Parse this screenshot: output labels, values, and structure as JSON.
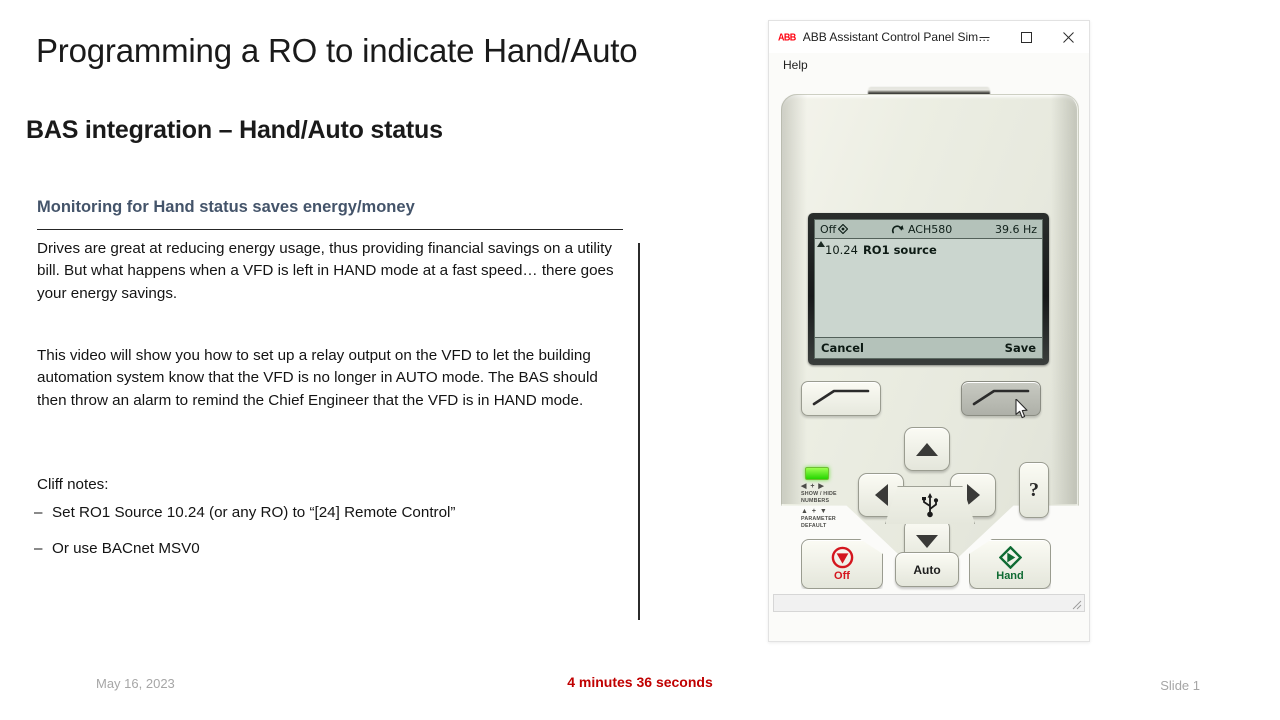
{
  "slide": {
    "title": "Programming a RO to indicate Hand/Auto",
    "subtitle": "BAS integration – Hand/Auto status",
    "section_heading": "Monitoring for Hand status saves energy/money",
    "section_heading_color": "#44546a",
    "paragraph_1": "Drives are great at reducing energy usage, thus providing financial savings on a utility bill.  But what happens when a VFD is left in HAND mode at a fast speed… there goes your energy savings.",
    "paragraph_2": "This video will show you how to set up a relay output on the VFD to let the building automation system know that the VFD is no longer in AUTO mode. The BAS should then throw an alarm to remind the Chief Engineer that the VFD is in HAND mode.",
    "cliff_label": "Cliff notes:",
    "bullets": [
      {
        "dash": "–",
        "text": "Set RO1 Source 10.24 (or any RO) to “[24] Remote Control”"
      },
      {
        "dash": "–",
        "text": "Or use BACnet MSV0"
      }
    ]
  },
  "footer": {
    "date": "May 16, 2023",
    "duration": "4 minutes 36 seconds",
    "duration_color": "#c00000",
    "slide_number": "Slide 1"
  },
  "app_window": {
    "logo_text": "ABB",
    "logo_color": "#ff000f",
    "title": "ABB Assistant Control Panel Sim…",
    "window_buttons": [
      {
        "name": "minimize",
        "label": "–"
      },
      {
        "name": "maximize",
        "label": "□"
      },
      {
        "name": "close",
        "label": "✕"
      }
    ],
    "menu": [
      {
        "label": "Help"
      }
    ]
  },
  "control_panel": {
    "lcd": {
      "status_left": "Off",
      "status_left_icon": "local-control-diamond-icon",
      "status_rotate_icon": "rotation-direction-icon",
      "drive_name": "ACH580",
      "frequency": "39.6 Hz",
      "parameter_number": "10.24",
      "parameter_name": "RO1 source",
      "softkey_left_label": "Cancel",
      "softkey_right_label": "Save",
      "background_color": "#c3cfc8"
    },
    "soft_keys": [
      {
        "name": "soft-key-left",
        "state": "normal"
      },
      {
        "name": "soft-key-right",
        "state": "pressed"
      }
    ],
    "nav_keys": [
      {
        "name": "nav-up-button",
        "icon": "triangle-up-icon"
      },
      {
        "name": "nav-left-button",
        "icon": "triangle-left-icon"
      },
      {
        "name": "nav-right-button",
        "icon": "triangle-right-icon"
      },
      {
        "name": "nav-down-button",
        "icon": "triangle-down-icon"
      }
    ],
    "help_key_label": "?",
    "legend": {
      "led_color": "#25d600",
      "combo_1": "◀ + ▶",
      "line_1a": "SHOW / HIDE",
      "line_1b": "NUMBERS",
      "combo_2": "▲ + ▼",
      "line_2a": "PARAMETER",
      "line_2b": "DEFAULT"
    },
    "mode_keys": {
      "off_label": "Off",
      "off_color": "#d4161e",
      "auto_label": "Auto",
      "hand_label": "Hand",
      "hand_color": "#0f6b33"
    },
    "usb_icon": "usb-port-icon"
  }
}
